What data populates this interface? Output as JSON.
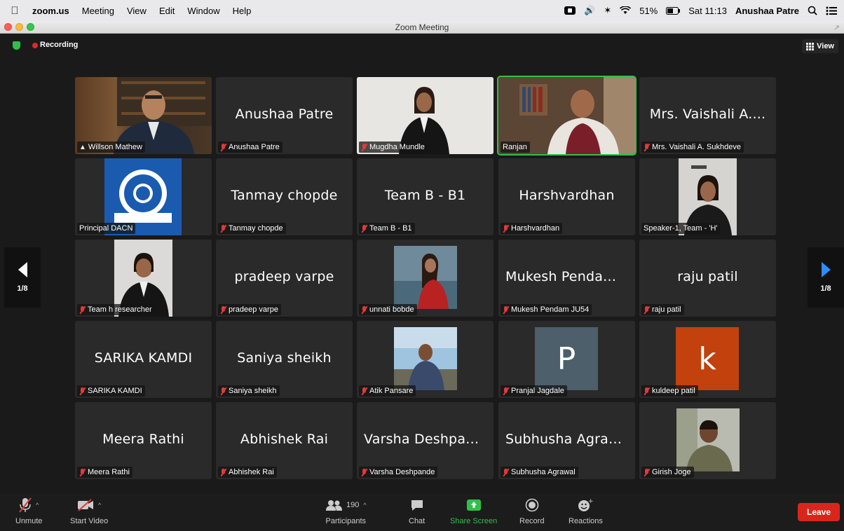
{
  "menubar": {
    "app_name": "zoom.us",
    "menus": [
      "Meeting",
      "View",
      "Edit",
      "Window",
      "Help"
    ],
    "battery": "51%",
    "clock": "Sat 11:13",
    "user": "Anushaa Patre"
  },
  "window": {
    "title": "Zoom Meeting"
  },
  "status": {
    "recording": "Recording",
    "view_label": "View"
  },
  "pager": {
    "left": "1/8",
    "right": "1/8"
  },
  "tiles": [
    {
      "big": "",
      "tag": "Willson Mathew"
    },
    {
      "big": "Anushaa Patre",
      "tag": "Anushaa Patre"
    },
    {
      "big": "",
      "tag": "Mugdha Mundle"
    },
    {
      "big": "",
      "tag": "Ranjan"
    },
    {
      "big": "Mrs. Vaishali A....",
      "tag": "Mrs. Vaishali A. Sukhdeve"
    },
    {
      "big": "",
      "tag": "Principal DACN"
    },
    {
      "big": "Tanmay chopde",
      "tag": "Tanmay chopde"
    },
    {
      "big": "Team B - B1",
      "tag": "Team B - B1"
    },
    {
      "big": "Harshvardhan",
      "tag": "Harshvardhan"
    },
    {
      "big": "",
      "tag": "Speaker-1, Team - 'H'"
    },
    {
      "big": "",
      "tag": "Team h researcher"
    },
    {
      "big": "pradeep varpe",
      "tag": "pradeep varpe"
    },
    {
      "big": "",
      "tag": "unnati bobde"
    },
    {
      "big": "Mukesh Pendam...",
      "tag": "Mukesh Pendam JU54"
    },
    {
      "big": "raju patil",
      "tag": "raju patil"
    },
    {
      "big": "SARIKA KAMDI",
      "tag": "SARIKA KAMDI"
    },
    {
      "big": "Saniya sheikh",
      "tag": "Saniya sheikh"
    },
    {
      "big": "",
      "tag": "Atik Pansare"
    },
    {
      "big": "",
      "tag": "Pranjal Jagdale"
    },
    {
      "big": "",
      "tag": "kuldeep patil"
    },
    {
      "big": "Meera Rathi",
      "tag": "Meera Rathi"
    },
    {
      "big": "Abhishek Rai",
      "tag": "Abhishek Rai"
    },
    {
      "big": "Varsha Deshpande",
      "tag": "Varsha Deshpande"
    },
    {
      "big": "Subhusha Agrawal",
      "tag": "Subhusha Agrawal"
    },
    {
      "big": "",
      "tag": "Girish Joge"
    }
  ],
  "avatars": {
    "pranjal": "P",
    "kuldeep": "k",
    "pranjal_color": "#4c5f6b",
    "kuldeep_color": "#c2410c"
  },
  "toolbar": {
    "unmute": "Unmute",
    "start_video": "Start Video",
    "participants": "Participants",
    "participant_count": "190",
    "chat": "Chat",
    "share_screen": "Share Screen",
    "record": "Record",
    "reactions": "Reactions",
    "leave": "Leave"
  },
  "colors": {
    "accent_green": "#30c04a",
    "leave_red": "#d9261c",
    "nav_blue": "#2d8cff"
  }
}
